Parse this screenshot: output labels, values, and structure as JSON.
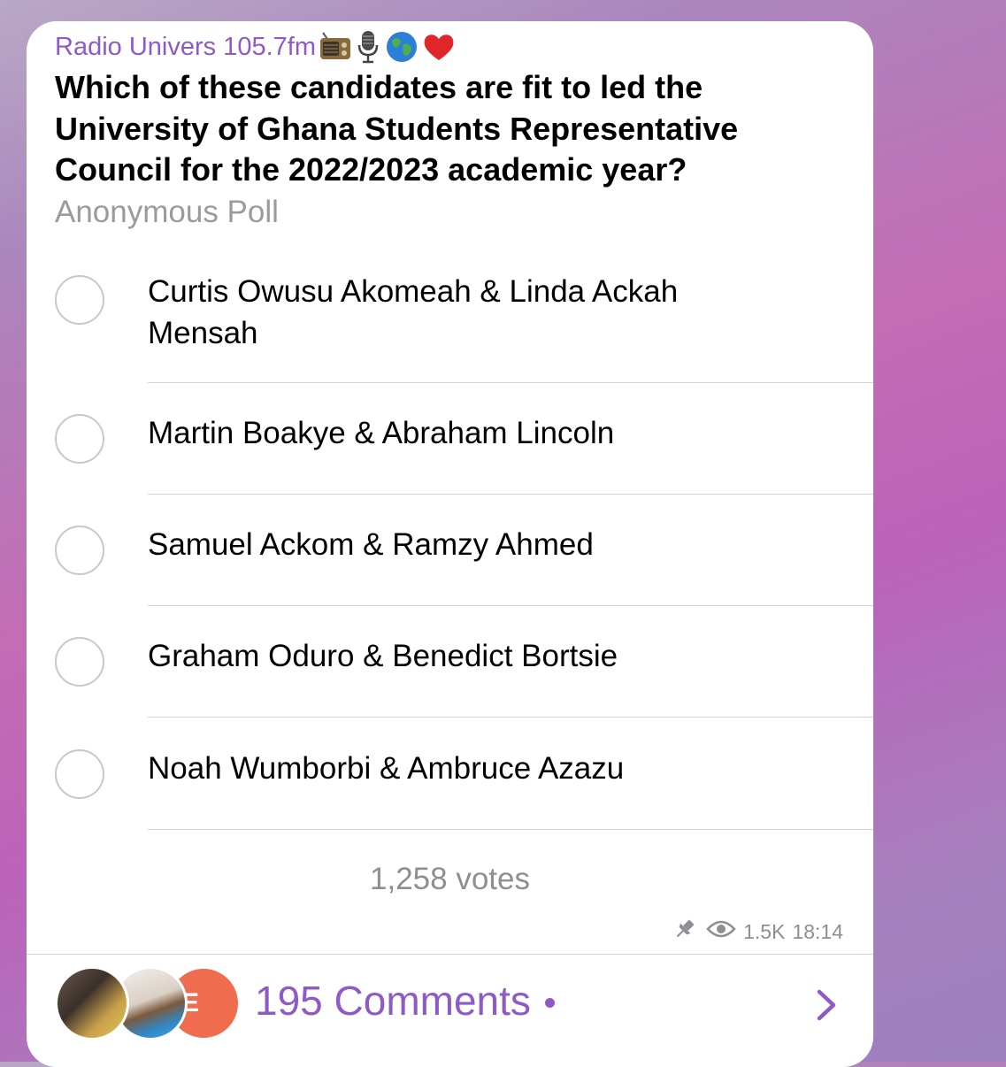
{
  "channel": {
    "name": "Radio Univers 105.7fm",
    "emoji_icons": [
      "radio-icon",
      "microphone-icon",
      "globe-icon",
      "heart-icon"
    ]
  },
  "poll": {
    "question": "Which of these candidates are fit to led the University of Ghana Students Representative Council for the 2022/2023 academic year?",
    "type_label": "Anonymous Poll",
    "options": [
      {
        "label": "Curtis Owusu Akomeah & Linda Ackah Mensah"
      },
      {
        "label": "Martin Boakye & Abraham Lincoln"
      },
      {
        "label": "Samuel Ackom & Ramzy Ahmed"
      },
      {
        "label": "Graham Oduro & Benedict Bortsie"
      },
      {
        "label": "Noah Wumborbi & Ambruce Azazu"
      }
    ],
    "votes": "1,258 votes"
  },
  "meta": {
    "views": "1.5K",
    "time": "18:14"
  },
  "footer": {
    "avatar_initial": "E",
    "comments_label": "195 Comments"
  },
  "colors": {
    "accent": "#8e5ac8",
    "secondary_text": "#8e8e93",
    "avatar_orange": "#ef6d4e"
  }
}
